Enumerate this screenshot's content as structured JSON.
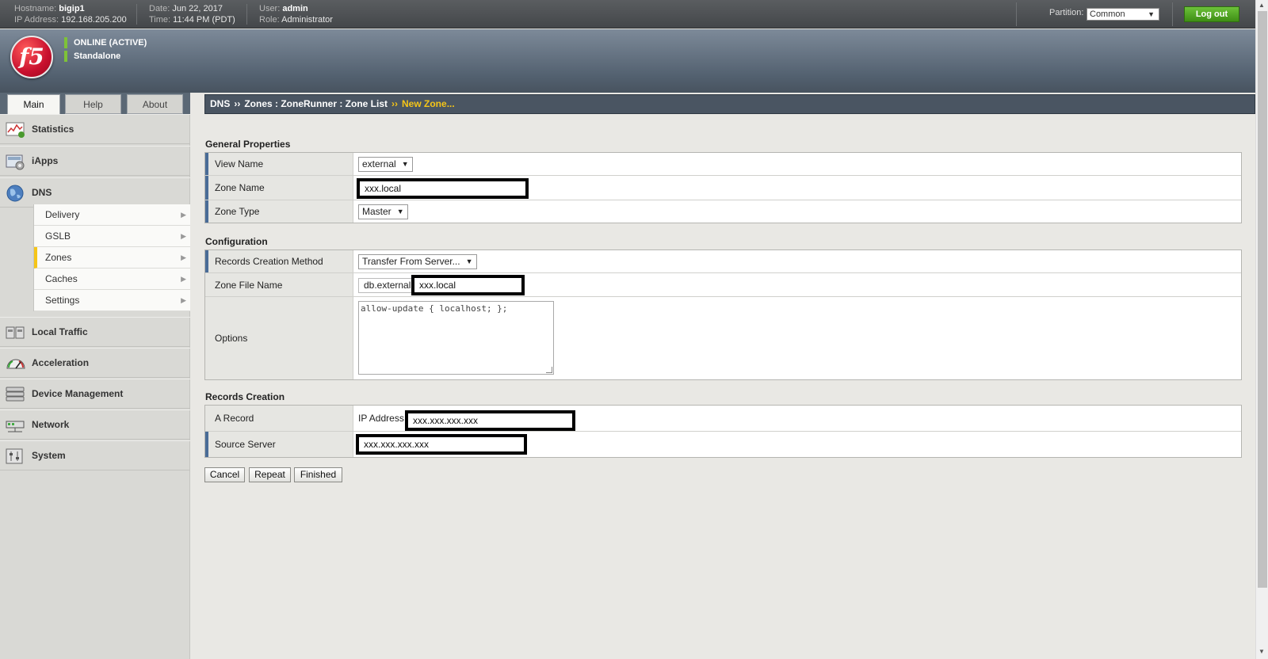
{
  "header": {
    "hostname_label": "Hostname:",
    "hostname": "bigip1",
    "ip_label": "IP Address:",
    "ip": "192.168.205.200",
    "date_label": "Date:",
    "date": "Jun 22, 2017",
    "time_label": "Time:",
    "time": "11:44 PM (PDT)",
    "user_label": "User:",
    "user": "admin",
    "role_label": "Role:",
    "role": "Administrator",
    "partition_label": "Partition:",
    "partition_value": "Common",
    "logout_label": "Log out"
  },
  "banner": {
    "logo_text": "f5",
    "status_online": "ONLINE (ACTIVE)",
    "status_mode": "Standalone",
    "status_color": "#7ec238"
  },
  "tabs": [
    {
      "label": "Main",
      "active": true
    },
    {
      "label": "Help",
      "active": false
    },
    {
      "label": "About",
      "active": false
    }
  ],
  "breadcrumb": {
    "part1": "DNS",
    "separator": "››",
    "part2": "Zones : ZoneRunner : Zone List",
    "current": "New Zone..."
  },
  "sidebar": {
    "items": [
      {
        "label": "Statistics",
        "icon": "statistics-icon"
      },
      {
        "label": "iApps",
        "icon": "iapps-icon"
      },
      {
        "label": "DNS",
        "icon": "globe-icon"
      },
      {
        "label": "Local Traffic",
        "icon": "local-traffic-icon"
      },
      {
        "label": "Acceleration",
        "icon": "gauge-icon"
      },
      {
        "label": "Device Management",
        "icon": "device-management-icon"
      },
      {
        "label": "Network",
        "icon": "network-icon"
      },
      {
        "label": "System",
        "icon": "system-icon"
      }
    ],
    "dns_subitems": [
      {
        "label": "Delivery",
        "active": false
      },
      {
        "label": "GSLB",
        "active": false
      },
      {
        "label": "Zones",
        "active": true
      },
      {
        "label": "Caches",
        "active": false
      },
      {
        "label": "Settings",
        "active": false
      }
    ]
  },
  "general": {
    "title": "General Properties",
    "view_name_label": "View Name",
    "view_name_value": "external",
    "zone_name_label": "Zone Name",
    "zone_name_value": "xxx.local",
    "zone_type_label": "Zone Type",
    "zone_type_value": "Master"
  },
  "configuration": {
    "title": "Configuration",
    "method_label": "Records Creation Method",
    "method_value": "Transfer From Server...",
    "zone_file_label": "Zone File Name",
    "zone_file_prefix": "db.external.",
    "zone_file_value": "xxx.local",
    "options_label": "Options",
    "options_value": "allow-update { localhost; };"
  },
  "records": {
    "title": "Records Creation",
    "a_record_label": "A Record",
    "ip_address_label": "IP Address",
    "ip_address_value": "xxx.xxx.xxx.xxx",
    "source_server_label": "Source Server",
    "source_server_value": "xxx.xxx.xxx.xxx"
  },
  "buttons": {
    "cancel": "Cancel",
    "repeat": "Repeat",
    "finished": "Finished"
  },
  "colors": {
    "accent_yellow": "#f5c518",
    "logout_green": "#4fa524",
    "required_bar": "#4a6c97",
    "brand_red": "#c8102e"
  }
}
